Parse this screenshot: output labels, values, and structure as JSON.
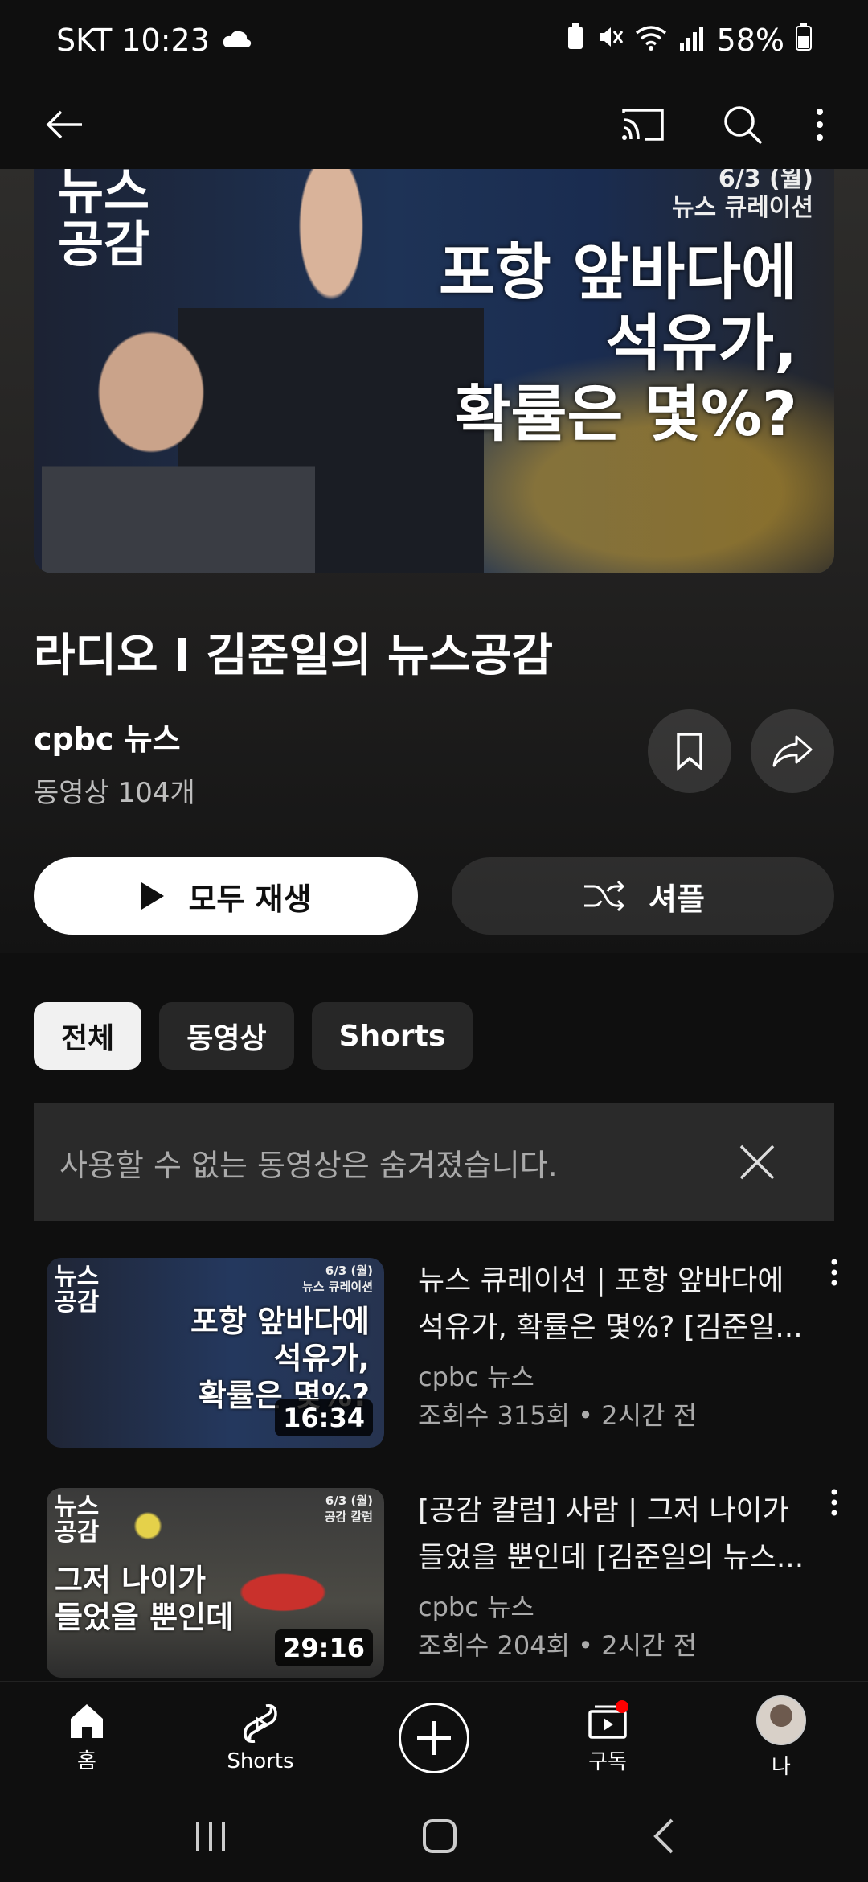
{
  "status_bar": {
    "carrier_time": "SKT 10:23",
    "battery": "58%"
  },
  "hero": {
    "logo": "뉴스\n공감",
    "date_line": "6/3 (월)",
    "tag_line": "뉴스 큐레이션",
    "headline_1": "포항 앞바다에",
    "headline_2": "석유가,",
    "headline_3": "확률은 몇%?"
  },
  "playlist": {
    "title": "라디오 I 김준일의 뉴스공감",
    "channel": "cpbc 뉴스",
    "video_count": "동영상 104개",
    "play_all_label": "모두 재생",
    "shuffle_label": "셔플"
  },
  "chips": [
    {
      "label": "전체",
      "active": true
    },
    {
      "label": "동영상",
      "active": false
    },
    {
      "label": "Shorts",
      "active": false
    }
  ],
  "notice": {
    "text": "사용할 수 없는 동영상은 숨겨졌습니다."
  },
  "videos": [
    {
      "title_line1": "뉴스 큐레이션 | 포항 앞바다에",
      "title_line2": "석유가, 확률은 몇%?  [김준일...",
      "channel": "cpbc 뉴스",
      "stats": "조회수 315회 • 2시간 전",
      "duration": "16:34",
      "thumb_logo": "뉴스\n공감",
      "thumb_date": "6/3 (월)",
      "thumb_tag": "뉴스 큐레이션",
      "thumb_headline_1": "포항 앞바다에",
      "thumb_headline_2": "석유가,",
      "thumb_headline_3": "확률은 몇%?"
    },
    {
      "title_line1": "[공감 칼럼] 사람 | 그저 나이가",
      "title_line2": "들었을 뿐인데 [김준일의 뉴스...",
      "channel": "cpbc 뉴스",
      "stats": "조회수 204회 • 2시간 전",
      "duration": "29:16",
      "thumb_logo": "뉴스\n공감",
      "thumb_date": "6/3 (월)",
      "thumb_tag": "공감 칼럼",
      "thumb_headline_1": "그저 나이가",
      "thumb_headline_2": "들었을 뿐인데"
    }
  ],
  "bottom_nav": {
    "home": "홈",
    "shorts": "Shorts",
    "subscriptions": "구독",
    "me": "나"
  },
  "colors": {
    "background": "#0f0f0f",
    "notification_dot": "#ff0000"
  }
}
